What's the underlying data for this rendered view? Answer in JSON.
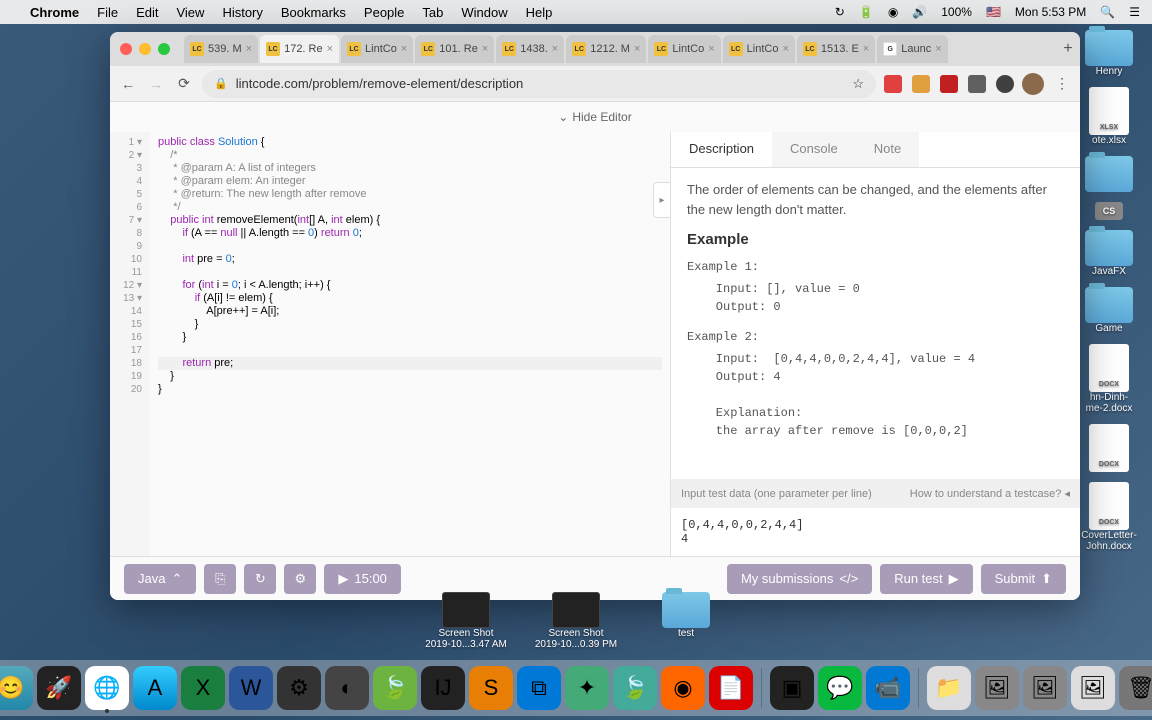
{
  "menubar": {
    "apple": "",
    "app": "Chrome",
    "items": [
      "File",
      "Edit",
      "View",
      "History",
      "Bookmarks",
      "People",
      "Tab",
      "Window",
      "Help"
    ],
    "battery": "100%",
    "clock": "Mon 5:53 PM"
  },
  "tabs": [
    {
      "label": "539. M",
      "fav": "LC"
    },
    {
      "label": "172. Re",
      "fav": "LC",
      "active": true
    },
    {
      "label": "LintCo",
      "fav": "LC"
    },
    {
      "label": "101. Re",
      "fav": "LC"
    },
    {
      "label": "1438.",
      "fav": "LC"
    },
    {
      "label": "1212. M",
      "fav": "LC"
    },
    {
      "label": "LintCo",
      "fav": "LC"
    },
    {
      "label": "LintCo",
      "fav": "LC"
    },
    {
      "label": "1513. E",
      "fav": "LC"
    },
    {
      "label": "Launc",
      "fav": "G",
      "g": true
    }
  ],
  "url": "lintcode.com/problem/remove-element/description",
  "hide_editor": "Hide Editor",
  "code": {
    "lines": [
      {
        "n": "1",
        "fold": true,
        "html": "<span class='kw'>public</span> <span class='kw'>class</span> <span class='ty'>Solution</span> {"
      },
      {
        "n": "2",
        "fold": true,
        "html": "    <span class='cm'>/*</span>"
      },
      {
        "n": "3",
        "html": "<span class='cm'>     * @param A: A list of integers</span>"
      },
      {
        "n": "4",
        "html": "<span class='cm'>     * @param elem: An integer</span>"
      },
      {
        "n": "5",
        "html": "<span class='cm'>     * @return: The new length after remove</span>"
      },
      {
        "n": "6",
        "html": "<span class='cm'>     */</span>"
      },
      {
        "n": "7",
        "fold": true,
        "html": "    <span class='kw'>public</span> <span class='kw'>int</span> removeElement(<span class='kw'>int</span>[] A, <span class='kw'>int</span> elem) {"
      },
      {
        "n": "8",
        "html": "        <span class='kw'>if</span> (A == <span class='kw'>null</span> || A.length == <span class='num'>0</span>) <span class='kw'>return</span> <span class='num'>0</span>;"
      },
      {
        "n": "9",
        "html": ""
      },
      {
        "n": "10",
        "html": "        <span class='kw'>int</span> pre = <span class='num'>0</span>;"
      },
      {
        "n": "11",
        "html": ""
      },
      {
        "n": "12",
        "fold": true,
        "html": "        <span class='kw'>for</span> (<span class='kw'>int</span> i = <span class='num'>0</span>; i &lt; A.length; i++) {"
      },
      {
        "n": "13",
        "fold": true,
        "html": "            <span class='kw'>if</span> (A[i] != elem) {"
      },
      {
        "n": "14",
        "html": "                A[pre++] = A[i];"
      },
      {
        "n": "15",
        "html": "            }"
      },
      {
        "n": "16",
        "html": "        }"
      },
      {
        "n": "17",
        "html": ""
      },
      {
        "n": "18",
        "hl": true,
        "html": "        <span class='kw'>return</span> pre;"
      },
      {
        "n": "19",
        "html": "    }"
      },
      {
        "n": "20",
        "html": "}"
      }
    ]
  },
  "right": {
    "tabs": {
      "description": "Description",
      "console": "Console",
      "note": "Note"
    },
    "intro": "The order of elements can be changed, and the elements after the new length don't matter.",
    "example_h": "Example",
    "ex1_h": "Example 1:",
    "ex1": "    Input: [], value = 0\n    Output: 0",
    "ex2_h": "Example 2:",
    "ex2": "    Input:  [0,4,4,0,0,2,4,4], value = 4\n    Output: 4\n\n    Explanation:\n    the array after remove is [0,0,0,2]",
    "test_label": "Input test data (one parameter per line)",
    "test_hint": "How to understand a testcase? ◂",
    "test_data": "[0,4,4,0,0,2,4,4]\n4"
  },
  "bottom": {
    "lang": "Java",
    "timer": "15:00",
    "my_sub": "My submissions",
    "run": "Run test",
    "submit": "Submit"
  },
  "desktop": {
    "right": [
      {
        "type": "folder",
        "label": "Henry"
      },
      {
        "type": "xlsx",
        "label": "ote.xlsx"
      },
      {
        "type": "folder",
        "label": ""
      },
      {
        "type": "badge",
        "label": "CS"
      },
      {
        "type": "folder",
        "label": "JavaFX"
      },
      {
        "type": "folder",
        "label": "Game"
      },
      {
        "type": "docx",
        "label": "hn-Dinh-\nme-2.docx"
      },
      {
        "type": "docx",
        "label": ""
      },
      {
        "type": "docx",
        "label": "CoverLetter-\nJohn.docx"
      }
    ],
    "bottom": [
      {
        "type": "shot",
        "label": "Screen Shot\n2019-10...3.47 AM"
      },
      {
        "type": "shot",
        "label": "Screen Shot\n2019-10...0.39 PM"
      },
      {
        "type": "folder",
        "label": "test"
      }
    ]
  }
}
